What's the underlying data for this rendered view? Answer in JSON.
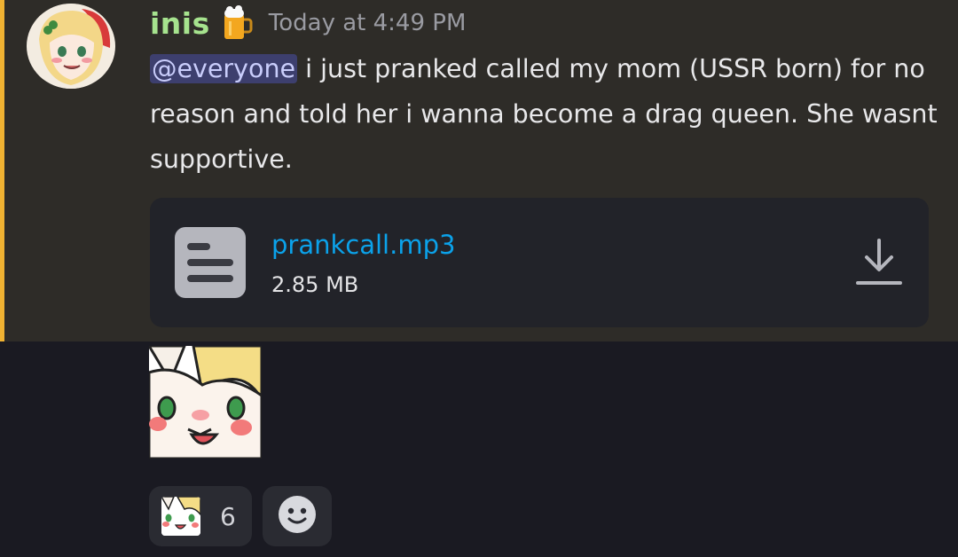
{
  "message": {
    "author": "inis",
    "author_badge_icon": "beer-mug-icon",
    "timestamp": "Today at 4:49 PM",
    "mention": "@everyone",
    "text": " i just pranked called my mom (USSR born) for no reason and told her i wanna become a drag queen. She wasnt supportive."
  },
  "attachment": {
    "file_name": "prankcall.mp3",
    "file_size": "2.85 MB",
    "file_icon": "document-icon",
    "download_icon": "download-icon"
  },
  "reactions": [
    {
      "emoji": "anime-face-sticker",
      "count": "6"
    }
  ],
  "add_reaction_icon": "smiley-face-icon",
  "colors": {
    "highlight_bg": "#2e2c28",
    "accent_bar": "#f0b232",
    "username": "#a6e38e",
    "mention_bg": "#3d3f6e",
    "link": "#0ba2ea"
  }
}
